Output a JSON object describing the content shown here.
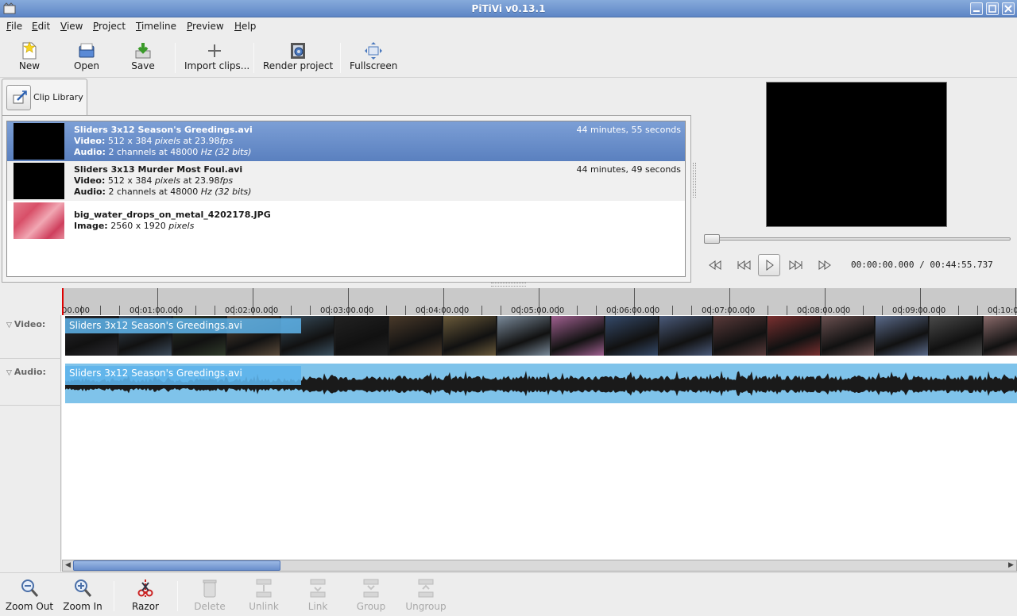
{
  "window": {
    "title": "PiTiVi v0.13.1"
  },
  "menu": [
    {
      "label": "File",
      "key": "F",
      "rest": "ile"
    },
    {
      "label": "Edit",
      "key": "E",
      "rest": "dit"
    },
    {
      "label": "View",
      "key": "V",
      "rest": "iew"
    },
    {
      "label": "Project",
      "key": "P",
      "rest": "roject"
    },
    {
      "label": "Timeline",
      "key": "T",
      "rest": "imeline"
    },
    {
      "label": "Preview",
      "key": "P",
      "rest": "review"
    },
    {
      "label": "Help",
      "key": "H",
      "rest": "elp"
    }
  ],
  "toolbar": {
    "new": "New",
    "open": "Open",
    "save": "Save",
    "import": "Import clips...",
    "render": "Render project",
    "fullscreen": "Fullscreen"
  },
  "library": {
    "tab_label": "Clip Library",
    "clips": [
      {
        "name": "Sliders 3x12 Season's Greedings.avi",
        "duration": "44 minutes, 55 seconds",
        "video_key": "Video:",
        "video": "512 x 384",
        "video_unit": "pixels",
        "video_at": "at 23.98",
        "video_fps": "fps",
        "audio_key": "Audio:",
        "audio": "2 channels at 48000",
        "audio_hz": "Hz",
        "audio_bits": "(32 bits)"
      },
      {
        "name": "Sliders 3x13 Murder Most Foul.avi",
        "duration": "44 minutes, 49 seconds",
        "video_key": "Video:",
        "video": "512 x 384",
        "video_unit": "pixels",
        "video_at": "at 23.98",
        "video_fps": "fps",
        "audio_key": "Audio:",
        "audio": "2 channels at 48000",
        "audio_hz": "Hz",
        "audio_bits": "(32 bits)"
      },
      {
        "name": "big_water_drops_on_metal_4202178.JPG",
        "image_key": "Image:",
        "image": "2560 x 1920",
        "image_unit": "pixels"
      }
    ]
  },
  "preview": {
    "timecode": "00:00:00.000 / 00:44:55.737",
    "seek_position": 0
  },
  "timeline": {
    "ruler_labels": [
      "00.000",
      "00:01:00.000",
      "00:02:00.000",
      "00:03:00.000",
      "00:04:00.000",
      "00:05:00.000",
      "00:06:00.000",
      "00:07:00.000",
      "00:08:00.000",
      "00:09:00.000",
      "00:10:0"
    ],
    "tracks": {
      "video": "Video:",
      "audio": "Audio:"
    },
    "video_clip_title": "Sliders 3x12 Season's Greedings.avi",
    "audio_clip_title": "Sliders 3x12 Season's Greedings.avi"
  },
  "bottombar": {
    "zoom_out": "Zoom Out",
    "zoom_in": "Zoom In",
    "razor": "Razor",
    "delete": "Delete",
    "unlink": "Unlink",
    "link": "Link",
    "group": "Group",
    "ungroup": "Ungroup"
  },
  "colors": {
    "selection": "#6f93cf",
    "clip_title": "#5eb4eb",
    "waveform": "#1a1a1a",
    "audio_bg": "#7fc3ea",
    "playhead": "#dd0000"
  }
}
